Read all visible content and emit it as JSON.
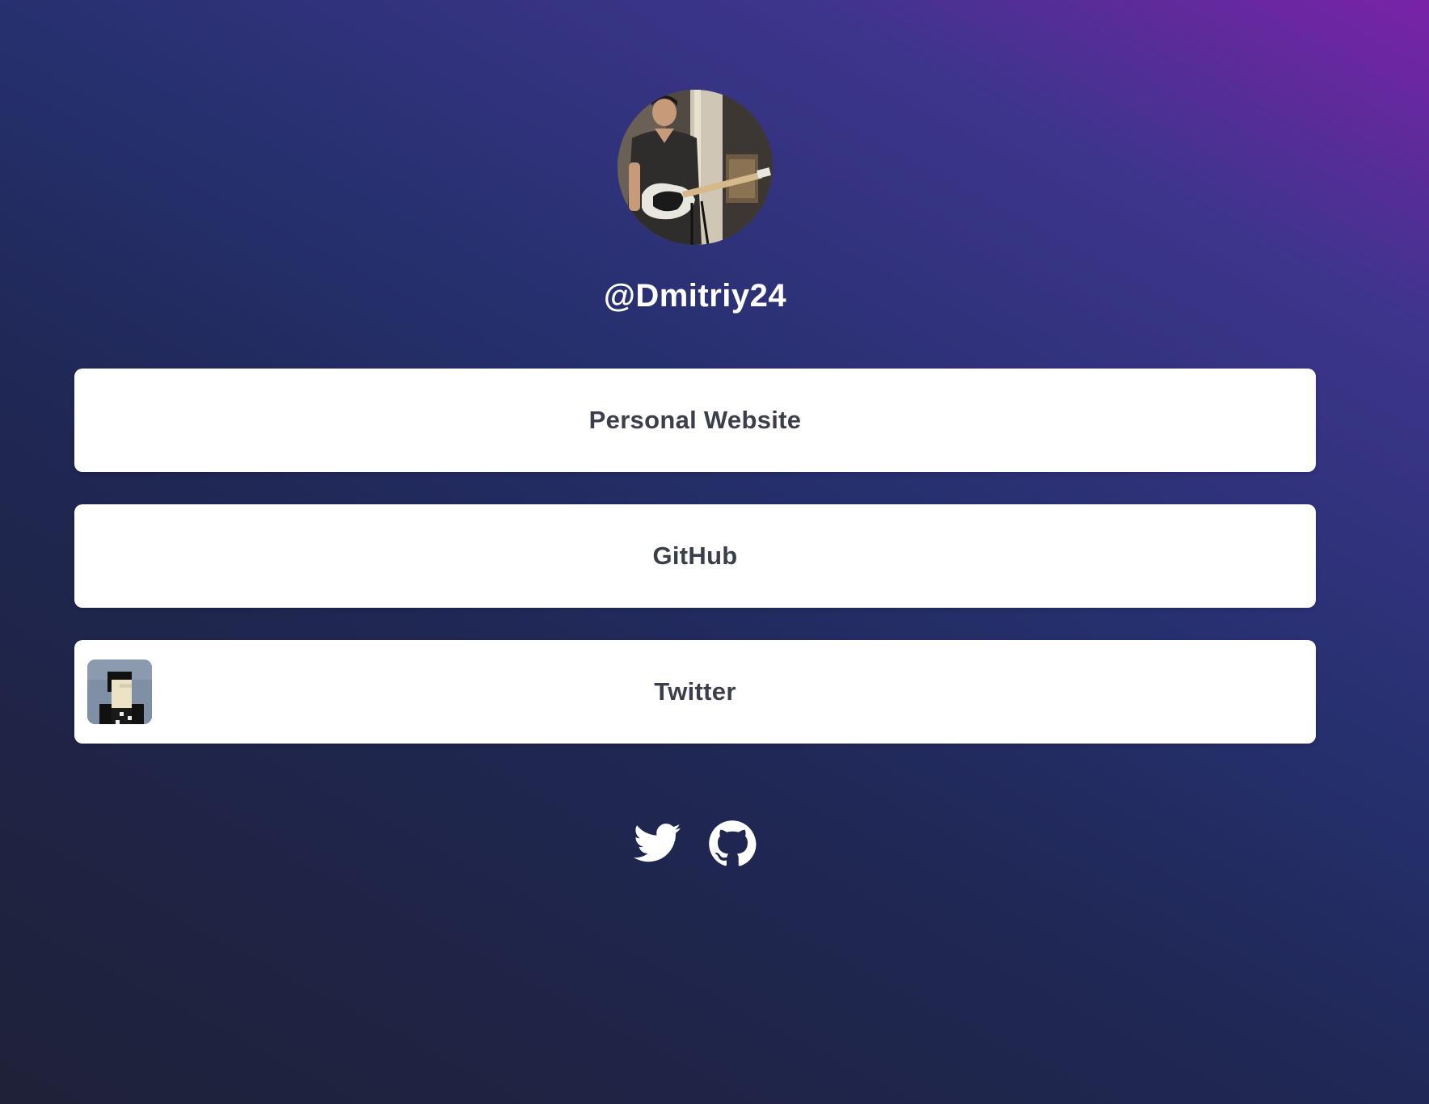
{
  "profile": {
    "username": "@Dmitriy24",
    "avatar_icon": "profile-photo"
  },
  "links": [
    {
      "label": "Personal Website"
    },
    {
      "label": "GitHub"
    },
    {
      "label": "Twitter",
      "thumbnail_icon": "pixel-avatar-icon"
    }
  ],
  "socials": [
    {
      "icon": "twitter-icon"
    },
    {
      "icon": "github-icon"
    }
  ],
  "colors": {
    "background_top_right": "#7a22a8",
    "background_middle": "#26306e",
    "background_bottom": "#1f2138",
    "card_background": "#ffffff",
    "card_text": "#3a3f4b",
    "username_text": "#ffffff"
  }
}
